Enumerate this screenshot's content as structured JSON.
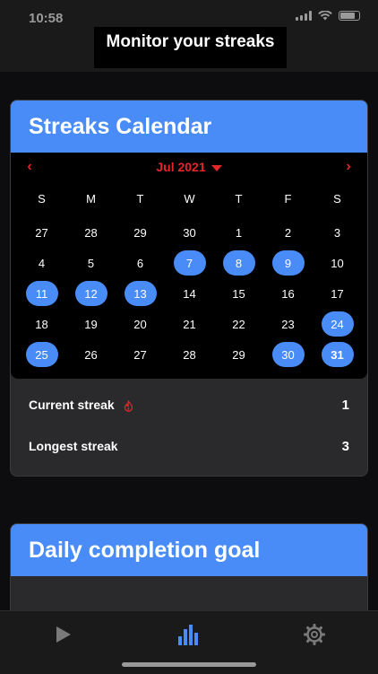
{
  "status": {
    "time": "10:58"
  },
  "header": {
    "title": "Monitor your streaks"
  },
  "calendar_card": {
    "title": "Streaks Calendar",
    "month": "Jul 2021",
    "weekdays": [
      "S",
      "M",
      "T",
      "W",
      "T",
      "F",
      "S"
    ],
    "weeks": [
      [
        "27",
        "28",
        "29",
        "30",
        "1",
        "2",
        "3"
      ],
      [
        "4",
        "5",
        "6",
        "7",
        "8",
        "9",
        "10"
      ],
      [
        "11",
        "12",
        "13",
        "14",
        "15",
        "16",
        "17"
      ],
      [
        "18",
        "19",
        "20",
        "21",
        "22",
        "23",
        "24"
      ],
      [
        "25",
        "26",
        "27",
        "28",
        "29",
        "30",
        "31"
      ]
    ],
    "streak_days": [
      "7",
      "8",
      "9",
      "11",
      "12",
      "13",
      "24",
      "25",
      "30",
      "31"
    ],
    "today": "31",
    "stats": {
      "current_label": "Current streak",
      "current_value": "1",
      "longest_label": "Longest streak",
      "longest_value": "3"
    }
  },
  "goal_card": {
    "title": "Daily completion goal"
  },
  "colors": {
    "accent": "#4a8cf7",
    "nav_red": "#e3262a"
  },
  "tabs": [
    {
      "icon": "play-icon",
      "active": false
    },
    {
      "icon": "bar-chart-icon",
      "active": true
    },
    {
      "icon": "gear-icon",
      "active": false
    }
  ]
}
